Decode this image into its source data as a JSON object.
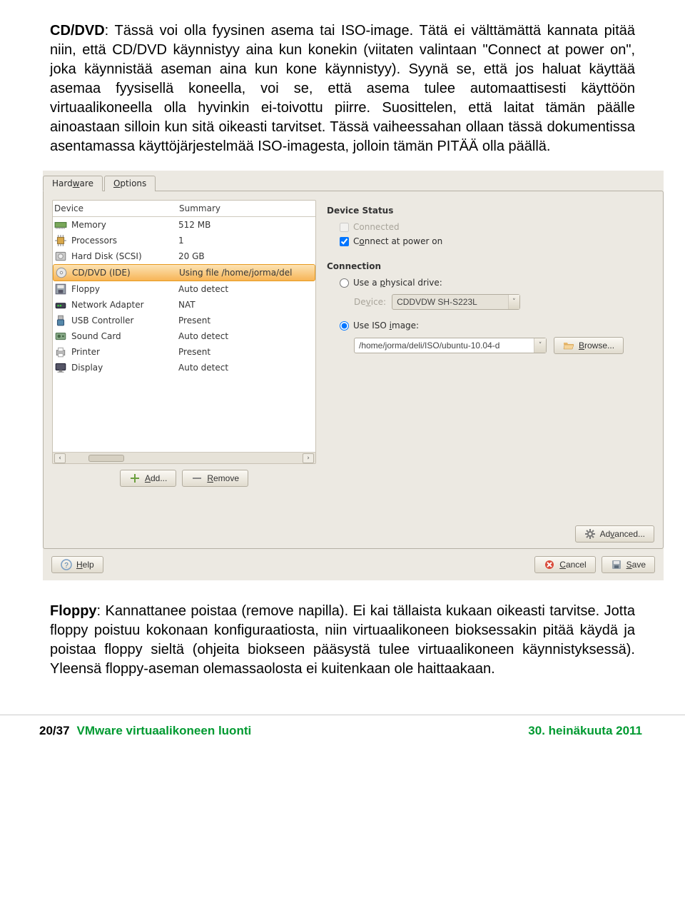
{
  "doc": {
    "para1_lead": "CD/DVD",
    "para1_rest": ": Tässä voi olla fyysinen asema tai ISO-image. Tätä ei välttämättä kannata pitää niin, että CD/DVD käynnistyy aina kun konekin (viitaten valintaan \"Connect at power on\", joka käynnistää aseman aina kun kone käynnistyy). Syynä se, että jos haluat käyttää asemaa fyysisellä koneella, voi se, että asema tulee automaattisesti käyttöön virtuaalikoneella olla hyvinkin ei-toivottu piirre. Suosittelen, että laitat tämän päälle ainoastaan silloin kun sitä oikeasti tarvitset. Tässä vaiheessahan ollaan tässä dokumentissa asentamassa käyttöjärjestelmää ISO-imagesta, jolloin tämän PITÄÄ olla päällä.",
    "para2_lead": "Floppy",
    "para2_rest": ": Kannattanee poistaa (remove napilla). Ei kai tällaista kukaan oikeasti tarvitse. Jotta floppy poistuu kokonaan konfiguraatiosta, niin virtuaalikoneen bioksessakin pitää käydä ja poistaa floppy sieltä (ohjeita biokseen pääsystä tulee virtuaalikoneen käynnistyksessä). Yleensä floppy-aseman olemassaolosta ei kuitenkaan ole haittaakaan."
  },
  "dialog": {
    "tabs": {
      "hardware": "Hardware",
      "options": "Options"
    },
    "list": {
      "col_device": "Device",
      "col_summary": "Summary",
      "rows": [
        {
          "name": "Memory",
          "summary": "512 MB",
          "icon": "memory"
        },
        {
          "name": "Processors",
          "summary": "1",
          "icon": "cpu"
        },
        {
          "name": "Hard Disk (SCSI)",
          "summary": "20 GB",
          "icon": "hdd"
        },
        {
          "name": "CD/DVD (IDE)",
          "summary": "Using file /home/jorma/del",
          "icon": "cd",
          "selected": true
        },
        {
          "name": "Floppy",
          "summary": "Auto detect",
          "icon": "floppy"
        },
        {
          "name": "Network Adapter",
          "summary": "NAT",
          "icon": "net"
        },
        {
          "name": "USB Controller",
          "summary": "Present",
          "icon": "usb"
        },
        {
          "name": "Sound Card",
          "summary": "Auto detect",
          "icon": "sound"
        },
        {
          "name": "Printer",
          "summary": "Present",
          "icon": "printer"
        },
        {
          "name": "Display",
          "summary": "Auto detect",
          "icon": "display"
        }
      ],
      "add": "Add...",
      "remove": "Remove"
    },
    "right": {
      "status_title": "Device Status",
      "connected": "Connected",
      "connect_power": "Connect at power on",
      "conn_title": "Connection",
      "use_physical": "Use a physical drive:",
      "device_label": "Device:",
      "device_value": "CDDVDW SH-S223L",
      "use_iso": "Use ISO image:",
      "iso_path": "/home/jorma/deli/ISO/ubuntu-10.04-d",
      "browse": "Browse...",
      "advanced": "Advanced..."
    },
    "footer": {
      "help": "Help",
      "cancel": "Cancel",
      "save": "Save"
    }
  },
  "footer": {
    "page": "20/37",
    "title": "VMware virtuaalikoneen luonti",
    "date": "30. heinäkuuta 2011"
  }
}
